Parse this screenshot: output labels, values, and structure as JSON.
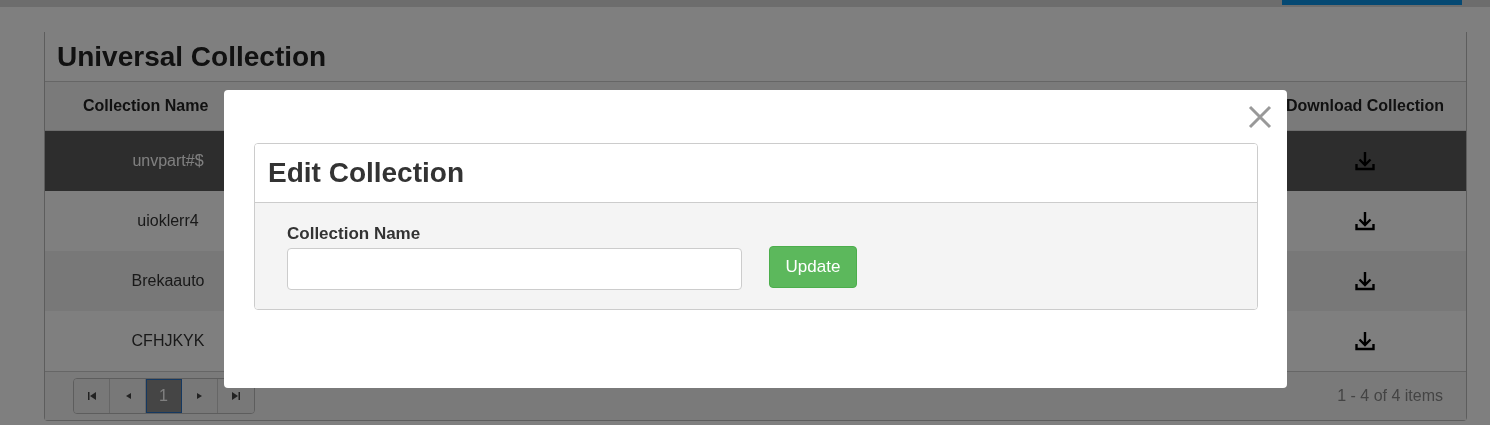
{
  "page": {
    "title": "Universal Collection"
  },
  "table": {
    "columns": [
      "Collection Name",
      "Download Collection"
    ],
    "rows": [
      {
        "name": "unvpart#$",
        "selected": true
      },
      {
        "name": "uioklerr4",
        "selected": false
      },
      {
        "name": "Brekaauto",
        "selected": false
      },
      {
        "name": "CFHJKYK",
        "selected": false
      }
    ]
  },
  "pager": {
    "pages": [
      {
        "label": "1",
        "selected": true
      }
    ],
    "summary": "1 - 4 of 4 items"
  },
  "modal": {
    "title": "Edit Collection",
    "field": {
      "label": "Collection Name"
    },
    "button": "Update"
  }
}
